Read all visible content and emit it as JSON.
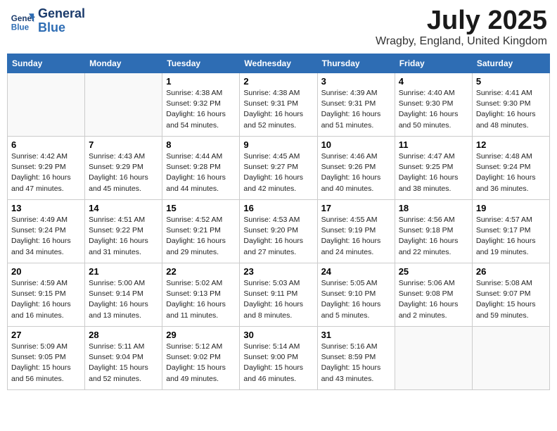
{
  "header": {
    "logo_line1": "General",
    "logo_line2": "Blue",
    "month": "July 2025",
    "location": "Wragby, England, United Kingdom"
  },
  "weekdays": [
    "Sunday",
    "Monday",
    "Tuesday",
    "Wednesday",
    "Thursday",
    "Friday",
    "Saturday"
  ],
  "weeks": [
    [
      {
        "day": "",
        "info": ""
      },
      {
        "day": "",
        "info": ""
      },
      {
        "day": "1",
        "info": "Sunrise: 4:38 AM\nSunset: 9:32 PM\nDaylight: 16 hours and 54 minutes."
      },
      {
        "day": "2",
        "info": "Sunrise: 4:38 AM\nSunset: 9:31 PM\nDaylight: 16 hours and 52 minutes."
      },
      {
        "day": "3",
        "info": "Sunrise: 4:39 AM\nSunset: 9:31 PM\nDaylight: 16 hours and 51 minutes."
      },
      {
        "day": "4",
        "info": "Sunrise: 4:40 AM\nSunset: 9:30 PM\nDaylight: 16 hours and 50 minutes."
      },
      {
        "day": "5",
        "info": "Sunrise: 4:41 AM\nSunset: 9:30 PM\nDaylight: 16 hours and 48 minutes."
      }
    ],
    [
      {
        "day": "6",
        "info": "Sunrise: 4:42 AM\nSunset: 9:29 PM\nDaylight: 16 hours and 47 minutes."
      },
      {
        "day": "7",
        "info": "Sunrise: 4:43 AM\nSunset: 9:29 PM\nDaylight: 16 hours and 45 minutes."
      },
      {
        "day": "8",
        "info": "Sunrise: 4:44 AM\nSunset: 9:28 PM\nDaylight: 16 hours and 44 minutes."
      },
      {
        "day": "9",
        "info": "Sunrise: 4:45 AM\nSunset: 9:27 PM\nDaylight: 16 hours and 42 minutes."
      },
      {
        "day": "10",
        "info": "Sunrise: 4:46 AM\nSunset: 9:26 PM\nDaylight: 16 hours and 40 minutes."
      },
      {
        "day": "11",
        "info": "Sunrise: 4:47 AM\nSunset: 9:25 PM\nDaylight: 16 hours and 38 minutes."
      },
      {
        "day": "12",
        "info": "Sunrise: 4:48 AM\nSunset: 9:24 PM\nDaylight: 16 hours and 36 minutes."
      }
    ],
    [
      {
        "day": "13",
        "info": "Sunrise: 4:49 AM\nSunset: 9:24 PM\nDaylight: 16 hours and 34 minutes."
      },
      {
        "day": "14",
        "info": "Sunrise: 4:51 AM\nSunset: 9:22 PM\nDaylight: 16 hours and 31 minutes."
      },
      {
        "day": "15",
        "info": "Sunrise: 4:52 AM\nSunset: 9:21 PM\nDaylight: 16 hours and 29 minutes."
      },
      {
        "day": "16",
        "info": "Sunrise: 4:53 AM\nSunset: 9:20 PM\nDaylight: 16 hours and 27 minutes."
      },
      {
        "day": "17",
        "info": "Sunrise: 4:55 AM\nSunset: 9:19 PM\nDaylight: 16 hours and 24 minutes."
      },
      {
        "day": "18",
        "info": "Sunrise: 4:56 AM\nSunset: 9:18 PM\nDaylight: 16 hours and 22 minutes."
      },
      {
        "day": "19",
        "info": "Sunrise: 4:57 AM\nSunset: 9:17 PM\nDaylight: 16 hours and 19 minutes."
      }
    ],
    [
      {
        "day": "20",
        "info": "Sunrise: 4:59 AM\nSunset: 9:15 PM\nDaylight: 16 hours and 16 minutes."
      },
      {
        "day": "21",
        "info": "Sunrise: 5:00 AM\nSunset: 9:14 PM\nDaylight: 16 hours and 13 minutes."
      },
      {
        "day": "22",
        "info": "Sunrise: 5:02 AM\nSunset: 9:13 PM\nDaylight: 16 hours and 11 minutes."
      },
      {
        "day": "23",
        "info": "Sunrise: 5:03 AM\nSunset: 9:11 PM\nDaylight: 16 hours and 8 minutes."
      },
      {
        "day": "24",
        "info": "Sunrise: 5:05 AM\nSunset: 9:10 PM\nDaylight: 16 hours and 5 minutes."
      },
      {
        "day": "25",
        "info": "Sunrise: 5:06 AM\nSunset: 9:08 PM\nDaylight: 16 hours and 2 minutes."
      },
      {
        "day": "26",
        "info": "Sunrise: 5:08 AM\nSunset: 9:07 PM\nDaylight: 15 hours and 59 minutes."
      }
    ],
    [
      {
        "day": "27",
        "info": "Sunrise: 5:09 AM\nSunset: 9:05 PM\nDaylight: 15 hours and 56 minutes."
      },
      {
        "day": "28",
        "info": "Sunrise: 5:11 AM\nSunset: 9:04 PM\nDaylight: 15 hours and 52 minutes."
      },
      {
        "day": "29",
        "info": "Sunrise: 5:12 AM\nSunset: 9:02 PM\nDaylight: 15 hours and 49 minutes."
      },
      {
        "day": "30",
        "info": "Sunrise: 5:14 AM\nSunset: 9:00 PM\nDaylight: 15 hours and 46 minutes."
      },
      {
        "day": "31",
        "info": "Sunrise: 5:16 AM\nSunset: 8:59 PM\nDaylight: 15 hours and 43 minutes."
      },
      {
        "day": "",
        "info": ""
      },
      {
        "day": "",
        "info": ""
      }
    ]
  ]
}
